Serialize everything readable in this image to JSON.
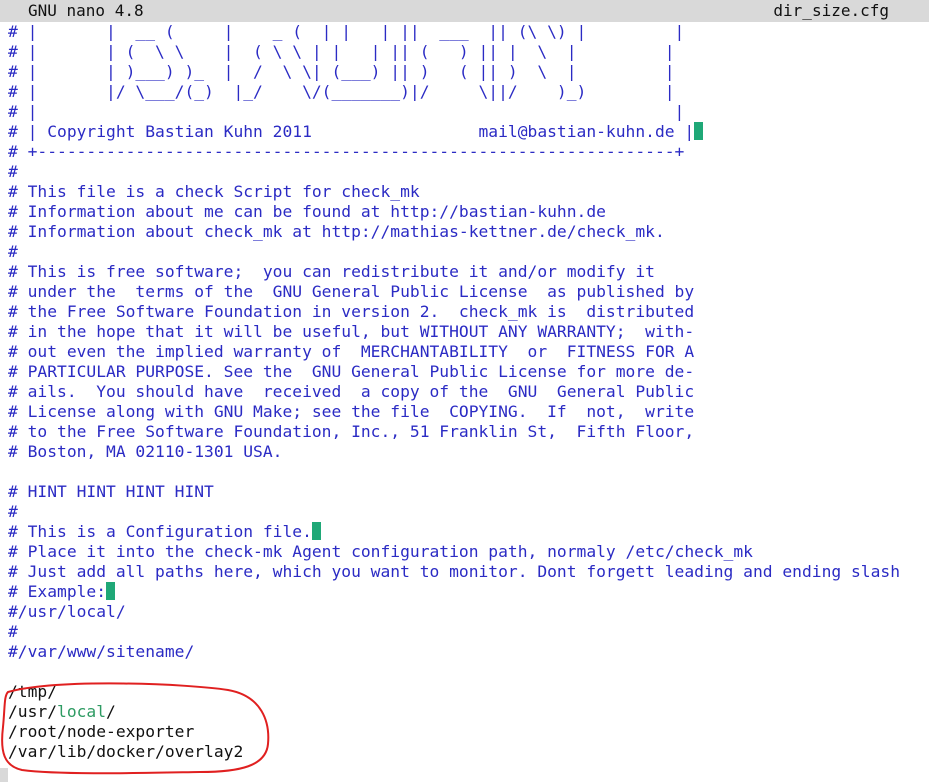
{
  "titlebar": {
    "app_name": "GNU nano 4.8",
    "file_name": "dir_size.cfg"
  },
  "lines": [
    {
      "text": "# |       |  __ (     |    _ (  | |   | ||  ___  || (\\ \\) |         |",
      "style": "comment",
      "mark": false
    },
    {
      "text": "# |       | (  \\ \\    |  ( \\ \\ | |   | || (   ) || |  \\  |         |",
      "style": "comment",
      "mark": false
    },
    {
      "text": "# |       | )___) )_  |  /  \\ \\| (___) || )   ( || )  \\  |         |",
      "style": "comment",
      "mark": false
    },
    {
      "text": "# |       |/ \\___/(_)  |_/    \\/(_______)|/     \\||/    )_)        |",
      "style": "comment",
      "mark": false
    },
    {
      "text": "# |                                                                 |",
      "style": "comment",
      "mark": false
    },
    {
      "text": "# | Copyright Bastian Kuhn 2011                 mail@bastian-kuhn.de |",
      "style": "comment",
      "mark": true
    },
    {
      "text": "# +-----------------------------------------------------------------+",
      "style": "comment",
      "mark": false
    },
    {
      "text": "#",
      "style": "comment",
      "mark": false
    },
    {
      "text": "# This file is a check Script for check_mk",
      "style": "comment",
      "mark": false
    },
    {
      "text": "# Information about me can be found at http://bastian-kuhn.de",
      "style": "comment",
      "mark": false
    },
    {
      "text": "# Information about check_mk at http://mathias-kettner.de/check_mk.",
      "style": "comment",
      "mark": false
    },
    {
      "text": "#",
      "style": "comment",
      "mark": false
    },
    {
      "text": "# This is free software;  you can redistribute it and/or modify it",
      "style": "comment",
      "mark": false
    },
    {
      "text": "# under the  terms of the  GNU General Public License  as published by",
      "style": "comment",
      "mark": false
    },
    {
      "text": "# the Free Software Foundation in version 2.  check_mk is  distributed",
      "style": "comment",
      "mark": false
    },
    {
      "text": "# in the hope that it will be useful, but WITHOUT ANY WARRANTY;  with-",
      "style": "comment",
      "mark": false
    },
    {
      "text": "# out even the implied warranty of  MERCHANTABILITY  or  FITNESS FOR A",
      "style": "comment",
      "mark": false
    },
    {
      "text": "# PARTICULAR PURPOSE. See the  GNU General Public License for more de-",
      "style": "comment",
      "mark": false
    },
    {
      "text": "# ails.  You should have  received  a copy of the  GNU  General Public",
      "style": "comment",
      "mark": false
    },
    {
      "text": "# License along with GNU Make; see the file  COPYING.  If  not,  write",
      "style": "comment",
      "mark": false
    },
    {
      "text": "# to the Free Software Foundation, Inc., 51 Franklin St,  Fifth Floor,",
      "style": "comment",
      "mark": false
    },
    {
      "text": "# Boston, MA 02110-1301 USA.",
      "style": "comment",
      "mark": false
    },
    {
      "text": "",
      "style": "plain",
      "mark": false
    },
    {
      "text": "# HINT HINT HINT HINT",
      "style": "comment",
      "mark": false
    },
    {
      "text": "#",
      "style": "comment",
      "mark": false
    },
    {
      "text": "# This is a Configuration file.",
      "style": "comment",
      "mark": true
    },
    {
      "text": "# Place it into the check-mk Agent configuration path, normaly /etc/check_mk",
      "style": "comment",
      "mark": false
    },
    {
      "text": "# Just add all paths here, which you want to monitor. Dont forgett leading and ending slash",
      "style": "comment",
      "mark": false
    },
    {
      "text": "# Example:",
      "style": "comment",
      "mark": true
    },
    {
      "text": "#/usr/local/",
      "style": "comment",
      "mark": false
    },
    {
      "text": "#",
      "style": "comment",
      "mark": false
    },
    {
      "text": "#/var/www/sitename/",
      "style": "comment",
      "mark": false
    },
    {
      "text": "",
      "style": "plain",
      "mark": false
    },
    {
      "text": "/tmp/",
      "style": "plain",
      "mark": false
    },
    {
      "segments": [
        {
          "text": "/usr/",
          "style": "plain"
        },
        {
          "text": "local",
          "style": "keyword"
        },
        {
          "text": "/",
          "style": "plain"
        }
      ],
      "mark": false
    },
    {
      "text": "/root/node-exporter",
      "style": "plain",
      "mark": false
    },
    {
      "text": "/var/lib/docker/overlay2",
      "style": "plain",
      "mark": false
    }
  ],
  "colors": {
    "comment": "#2b2bc4",
    "plain": "#111111",
    "keyword": "#2e9b63",
    "trailing_whitespace_mark": "#1fa877",
    "titlebar_bg": "#d9d9d9",
    "annotation": "#e02020"
  }
}
